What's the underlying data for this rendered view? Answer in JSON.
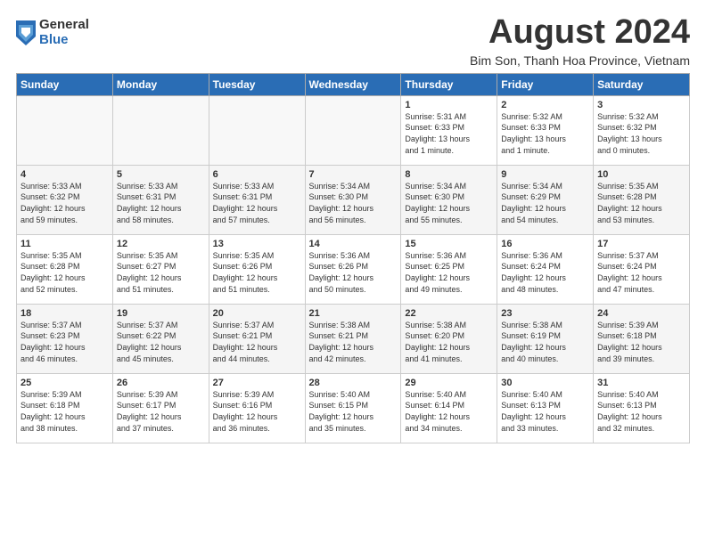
{
  "logo": {
    "general": "General",
    "blue": "Blue"
  },
  "title": "August 2024",
  "location": "Bim Son, Thanh Hoa Province, Vietnam",
  "weekdays": [
    "Sunday",
    "Monday",
    "Tuesday",
    "Wednesday",
    "Thursday",
    "Friday",
    "Saturday"
  ],
  "weeks": [
    [
      {
        "day": "",
        "detail": ""
      },
      {
        "day": "",
        "detail": ""
      },
      {
        "day": "",
        "detail": ""
      },
      {
        "day": "",
        "detail": ""
      },
      {
        "day": "1",
        "detail": "Sunrise: 5:31 AM\nSunset: 6:33 PM\nDaylight: 13 hours\nand 1 minute."
      },
      {
        "day": "2",
        "detail": "Sunrise: 5:32 AM\nSunset: 6:33 PM\nDaylight: 13 hours\nand 1 minute."
      },
      {
        "day": "3",
        "detail": "Sunrise: 5:32 AM\nSunset: 6:32 PM\nDaylight: 13 hours\nand 0 minutes."
      }
    ],
    [
      {
        "day": "4",
        "detail": "Sunrise: 5:33 AM\nSunset: 6:32 PM\nDaylight: 12 hours\nand 59 minutes."
      },
      {
        "day": "5",
        "detail": "Sunrise: 5:33 AM\nSunset: 6:31 PM\nDaylight: 12 hours\nand 58 minutes."
      },
      {
        "day": "6",
        "detail": "Sunrise: 5:33 AM\nSunset: 6:31 PM\nDaylight: 12 hours\nand 57 minutes."
      },
      {
        "day": "7",
        "detail": "Sunrise: 5:34 AM\nSunset: 6:30 PM\nDaylight: 12 hours\nand 56 minutes."
      },
      {
        "day": "8",
        "detail": "Sunrise: 5:34 AM\nSunset: 6:30 PM\nDaylight: 12 hours\nand 55 minutes."
      },
      {
        "day": "9",
        "detail": "Sunrise: 5:34 AM\nSunset: 6:29 PM\nDaylight: 12 hours\nand 54 minutes."
      },
      {
        "day": "10",
        "detail": "Sunrise: 5:35 AM\nSunset: 6:28 PM\nDaylight: 12 hours\nand 53 minutes."
      }
    ],
    [
      {
        "day": "11",
        "detail": "Sunrise: 5:35 AM\nSunset: 6:28 PM\nDaylight: 12 hours\nand 52 minutes."
      },
      {
        "day": "12",
        "detail": "Sunrise: 5:35 AM\nSunset: 6:27 PM\nDaylight: 12 hours\nand 51 minutes."
      },
      {
        "day": "13",
        "detail": "Sunrise: 5:35 AM\nSunset: 6:26 PM\nDaylight: 12 hours\nand 51 minutes."
      },
      {
        "day": "14",
        "detail": "Sunrise: 5:36 AM\nSunset: 6:26 PM\nDaylight: 12 hours\nand 50 minutes."
      },
      {
        "day": "15",
        "detail": "Sunrise: 5:36 AM\nSunset: 6:25 PM\nDaylight: 12 hours\nand 49 minutes."
      },
      {
        "day": "16",
        "detail": "Sunrise: 5:36 AM\nSunset: 6:24 PM\nDaylight: 12 hours\nand 48 minutes."
      },
      {
        "day": "17",
        "detail": "Sunrise: 5:37 AM\nSunset: 6:24 PM\nDaylight: 12 hours\nand 47 minutes."
      }
    ],
    [
      {
        "day": "18",
        "detail": "Sunrise: 5:37 AM\nSunset: 6:23 PM\nDaylight: 12 hours\nand 46 minutes."
      },
      {
        "day": "19",
        "detail": "Sunrise: 5:37 AM\nSunset: 6:22 PM\nDaylight: 12 hours\nand 45 minutes."
      },
      {
        "day": "20",
        "detail": "Sunrise: 5:37 AM\nSunset: 6:21 PM\nDaylight: 12 hours\nand 44 minutes."
      },
      {
        "day": "21",
        "detail": "Sunrise: 5:38 AM\nSunset: 6:21 PM\nDaylight: 12 hours\nand 42 minutes."
      },
      {
        "day": "22",
        "detail": "Sunrise: 5:38 AM\nSunset: 6:20 PM\nDaylight: 12 hours\nand 41 minutes."
      },
      {
        "day": "23",
        "detail": "Sunrise: 5:38 AM\nSunset: 6:19 PM\nDaylight: 12 hours\nand 40 minutes."
      },
      {
        "day": "24",
        "detail": "Sunrise: 5:39 AM\nSunset: 6:18 PM\nDaylight: 12 hours\nand 39 minutes."
      }
    ],
    [
      {
        "day": "25",
        "detail": "Sunrise: 5:39 AM\nSunset: 6:18 PM\nDaylight: 12 hours\nand 38 minutes."
      },
      {
        "day": "26",
        "detail": "Sunrise: 5:39 AM\nSunset: 6:17 PM\nDaylight: 12 hours\nand 37 minutes."
      },
      {
        "day": "27",
        "detail": "Sunrise: 5:39 AM\nSunset: 6:16 PM\nDaylight: 12 hours\nand 36 minutes."
      },
      {
        "day": "28",
        "detail": "Sunrise: 5:40 AM\nSunset: 6:15 PM\nDaylight: 12 hours\nand 35 minutes."
      },
      {
        "day": "29",
        "detail": "Sunrise: 5:40 AM\nSunset: 6:14 PM\nDaylight: 12 hours\nand 34 minutes."
      },
      {
        "day": "30",
        "detail": "Sunrise: 5:40 AM\nSunset: 6:13 PM\nDaylight: 12 hours\nand 33 minutes."
      },
      {
        "day": "31",
        "detail": "Sunrise: 5:40 AM\nSunset: 6:13 PM\nDaylight: 12 hours\nand 32 minutes."
      }
    ]
  ]
}
